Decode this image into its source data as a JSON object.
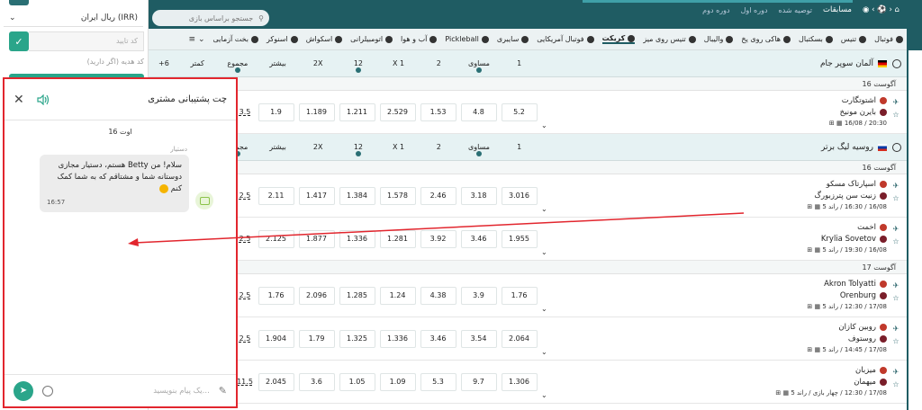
{
  "left": {
    "currency": "ریال ایران (IRR)",
    "code_placeholder": "کد تایید",
    "gift_text": "کد هدیه (اگر دارید)"
  },
  "chat": {
    "title": "چت پشتیبانی مشتری",
    "date": "16 اوت",
    "sender": "دستیار",
    "message": "سلام! من Betty هستم، دستیار مجازی دوستانه شما و مشتاقم که به شما کمک کنم",
    "time": "16:57",
    "input_placeholder": "یک پیام بنویسید..."
  },
  "topbar": {
    "search_placeholder": "جستجو براساس بازی",
    "competitions": "مسابقات",
    "recommended": "توصیه شده",
    "round1": "دوره اول",
    "round2": "دوره دوم"
  },
  "sports": [
    "فوتبال",
    "تنیس",
    "بسکتبال",
    "هاکی روی یخ",
    "والیبال",
    "تنیس روی میز",
    "کریکت",
    "فوتبال آمریکایی",
    "سایبری",
    "Pickleball",
    "آب و هوا",
    "اتومبیلرانی",
    "اسکواش",
    "اسنوکر",
    "بخت آزمایی"
  ],
  "headers": {
    "c1": "1",
    "cx": "مساوی",
    "c2": "2",
    "x1": "X 1",
    "h12": "12",
    "x2": "2X",
    "over": "بیشتر",
    "total": "مجموع",
    "under": "کمتر",
    "more": "+6"
  },
  "leagues": [
    {
      "name": "آلمان سوپر جام",
      "dates": [
        {
          "label": "16 آگوست",
          "matches": [
            {
              "home": "اشتوتگارت",
              "away": "بایرن مونیخ",
              "meta": "20:30 / 16/08",
              "odds": [
                "5.2",
                "4.8",
                "1.53",
                "2.529",
                "1.211",
                "1.189",
                "1.9"
              ],
              "total": "3.5"
            }
          ]
        }
      ]
    },
    {
      "name": "روسیه لیگ برتر",
      "dates": [
        {
          "label": "16 آگوست",
          "matches": [
            {
              "home": "اسپارتاک مسکو",
              "away": "زنیت سن پترزبورگ",
              "meta": "16/08 / 16:30 / راند 5",
              "odds": [
                "3.016",
                "3.18",
                "2.46",
                "1.578",
                "1.384",
                "1.417",
                "2.11"
              ],
              "total": "2.5"
            },
            {
              "home": "اخمت",
              "away": "Krylia Sovetov",
              "meta": "16/08 / 19:30 / راند 5",
              "odds": [
                "1.955",
                "3.46",
                "3.92",
                "1.281",
                "1.336",
                "1.877",
                "2.125"
              ],
              "total": "2.5"
            }
          ]
        },
        {
          "label": "17 آگوست",
          "matches": [
            {
              "home": "Akron Tolyatti",
              "away": "Orenburg",
              "meta": "17/08 / 12:30 / راند 5",
              "odds": [
                "1.76",
                "3.9",
                "4.38",
                "1.24",
                "1.285",
                "2.096",
                "1.76"
              ],
              "total": "2.5"
            },
            {
              "home": "روبین کازان",
              "away": "روستوف",
              "meta": "17/08 / 14:45 / راند 5",
              "odds": [
                "2.064",
                "3.54",
                "3.46",
                "1.336",
                "1.325",
                "1.79",
                "1.904"
              ],
              "total": "2.5"
            },
            {
              "home": "میزبان",
              "away": "میهمان",
              "meta": "17/08 / 12:30 / چهار بازی / راند 5",
              "odds": [
                "1.306",
                "9.7",
                "5.3",
                "1.09",
                "1.05",
                "3.6",
                "2.045"
              ],
              "total": "11.5"
            }
          ]
        }
      ]
    }
  ],
  "colors": {
    "primary": "#1f5c63",
    "accent": "#2aa58a",
    "highlight": "#e2262e"
  }
}
